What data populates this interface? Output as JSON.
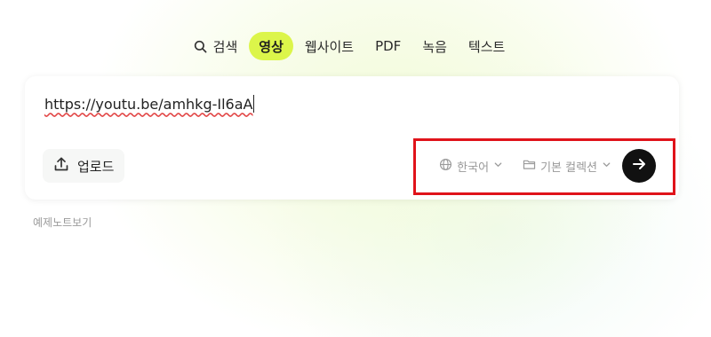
{
  "tabs": [
    {
      "label": "검색",
      "icon": "search-icon",
      "active": false
    },
    {
      "label": "영상",
      "active": true
    },
    {
      "label": "웹사이트",
      "active": false
    },
    {
      "label": "PDF",
      "active": false
    },
    {
      "label": "녹음",
      "active": false
    },
    {
      "label": "텍스트",
      "active": false
    }
  ],
  "input": {
    "value": "https://youtu.be/amhkg-Il6aA"
  },
  "upload": {
    "label": "업로드",
    "icon": "upload-icon"
  },
  "language": {
    "label": "한국어",
    "icon": "globe-icon"
  },
  "collection": {
    "label": "기본 컬렉션",
    "icon": "folder-icon"
  },
  "submit": {
    "icon": "arrow-right-icon"
  },
  "example_link": "예제노트보기",
  "colors": {
    "accent": "#dcf54a",
    "highlight_border": "#e0131a",
    "submit_bg": "#111111",
    "spellcheck_underline": "#e24646"
  }
}
